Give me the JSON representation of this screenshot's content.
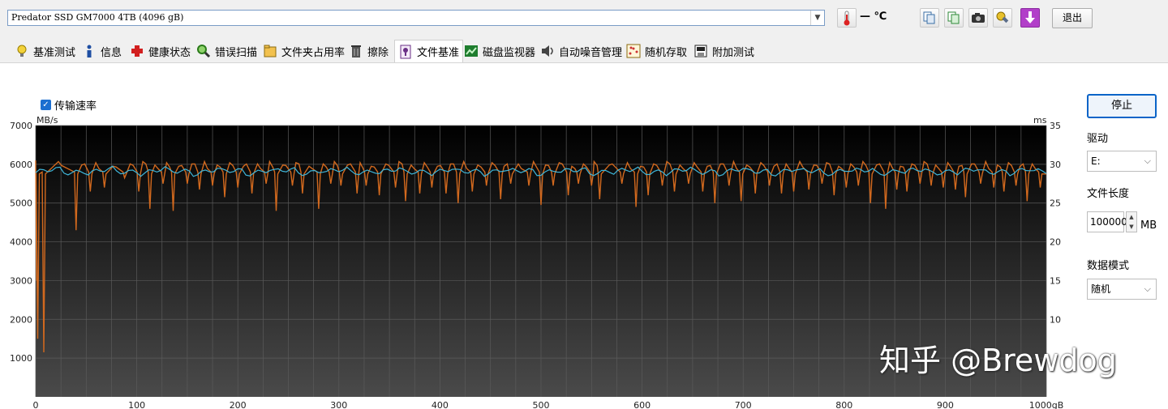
{
  "toolbar": {
    "drive_name": "Predator SSD GM7000 4TB (4096 gB)",
    "temperature": "— ℃",
    "exit_label": "退出"
  },
  "tabs": [
    {
      "label": "基准测试",
      "icon": "bulb-icon"
    },
    {
      "label": "信息",
      "icon": "info-icon"
    },
    {
      "label": "健康状态",
      "icon": "health-cross-icon"
    },
    {
      "label": "错误扫描",
      "icon": "magnifier-icon"
    },
    {
      "label": "文件夹占用率",
      "icon": "folder-icon"
    },
    {
      "label": "擦除",
      "icon": "trash-icon"
    },
    {
      "label": "文件基准",
      "icon": "file-benchmark-icon",
      "active": true
    },
    {
      "label": "磁盘监视器",
      "icon": "monitor-chart-icon"
    },
    {
      "label": "自动噪音管理",
      "icon": "speaker-icon"
    },
    {
      "label": "随机存取",
      "icon": "random-access-icon"
    },
    {
      "label": "附加测试",
      "icon": "extra-test-icon"
    }
  ],
  "main": {
    "checkbox_label": "传输速率",
    "checkbox_checked": true
  },
  "side": {
    "stop_label": "停止",
    "drive_label": "驱动",
    "drive_value": "E:",
    "filesize_label": "文件长度",
    "filesize_value": "100000",
    "filesize_unit": "MB",
    "datamode_label": "数据模式",
    "datamode_value": "随机"
  },
  "watermark": "知乎 @Brewdog",
  "chart_data": {
    "type": "line",
    "y_left_label": "MB/s",
    "y_right_label": "ms",
    "x_unit": "gB",
    "xlim": [
      0,
      1000
    ],
    "ylim_left": [
      0,
      7000
    ],
    "ylim_right": [
      0,
      35
    ],
    "x_ticks": [
      0,
      100,
      200,
      300,
      400,
      500,
      600,
      700,
      800,
      900,
      1000
    ],
    "x_tick_labels": [
      "0",
      "100",
      "200",
      "300",
      "400",
      "500",
      "600",
      "700",
      "800",
      "900",
      "1000gB"
    ],
    "y_left_ticks": [
      1000,
      2000,
      3000,
      4000,
      5000,
      6000,
      7000
    ],
    "y_right_ticks": [
      10,
      15,
      20,
      25,
      30,
      35
    ],
    "series_orange": {
      "color": "#d2691e",
      "dips": [
        [
          2,
          1500
        ],
        [
          8,
          1150
        ],
        [
          40,
          4300
        ],
        [
          54,
          5300
        ],
        [
          68,
          5400
        ],
        [
          88,
          5650
        ],
        [
          102,
          5300
        ],
        [
          113,
          4850
        ],
        [
          126,
          5500
        ],
        [
          136,
          4800
        ],
        [
          150,
          5500
        ],
        [
          162,
          5350
        ],
        [
          175,
          5450
        ],
        [
          187,
          5150
        ],
        [
          200,
          5400
        ],
        [
          214,
          5250
        ],
        [
          228,
          5500
        ],
        [
          238,
          4800
        ],
        [
          254,
          5450
        ],
        [
          264,
          5250
        ],
        [
          280,
          4850
        ],
        [
          292,
          5500
        ],
        [
          302,
          5450
        ],
        [
          318,
          5250
        ],
        [
          327,
          5450
        ],
        [
          340,
          5200
        ],
        [
          356,
          5400
        ],
        [
          366,
          5050
        ],
        [
          380,
          5250
        ],
        [
          392,
          5400
        ],
        [
          406,
          5250
        ],
        [
          418,
          5000
        ],
        [
          432,
          5300
        ],
        [
          446,
          5450
        ],
        [
          460,
          5100
        ],
        [
          470,
          5500
        ],
        [
          488,
          5450
        ],
        [
          500,
          4950
        ],
        [
          512,
          5450
        ],
        [
          527,
          5200
        ],
        [
          537,
          5500
        ],
        [
          550,
          5450
        ],
        [
          558,
          5100
        ],
        [
          580,
          5500
        ],
        [
          594,
          4900
        ],
        [
          606,
          5200
        ],
        [
          620,
          5450
        ],
        [
          632,
          5300
        ],
        [
          646,
          5500
        ],
        [
          660,
          5300
        ],
        [
          672,
          5000
        ],
        [
          686,
          5450
        ],
        [
          698,
          5050
        ],
        [
          712,
          5250
        ],
        [
          726,
          5450
        ],
        [
          738,
          5250
        ],
        [
          750,
          5300
        ],
        [
          765,
          5350
        ],
        [
          778,
          5500
        ],
        [
          790,
          5200
        ],
        [
          802,
          5400
        ],
        [
          814,
          5450
        ],
        [
          826,
          5000
        ],
        [
          841,
          4850
        ],
        [
          852,
          5350
        ],
        [
          862,
          5300
        ],
        [
          875,
          5500
        ],
        [
          886,
          5450
        ],
        [
          898,
          5400
        ],
        [
          910,
          5350
        ],
        [
          920,
          5150
        ],
        [
          935,
          5500
        ],
        [
          948,
          5400
        ],
        [
          958,
          5300
        ],
        [
          970,
          5450
        ],
        [
          981,
          5050
        ],
        [
          994,
          5400
        ]
      ],
      "baseline": 5950
    },
    "series_cyan": {
      "color": "#3fb6d9",
      "mean": 5820
    }
  }
}
